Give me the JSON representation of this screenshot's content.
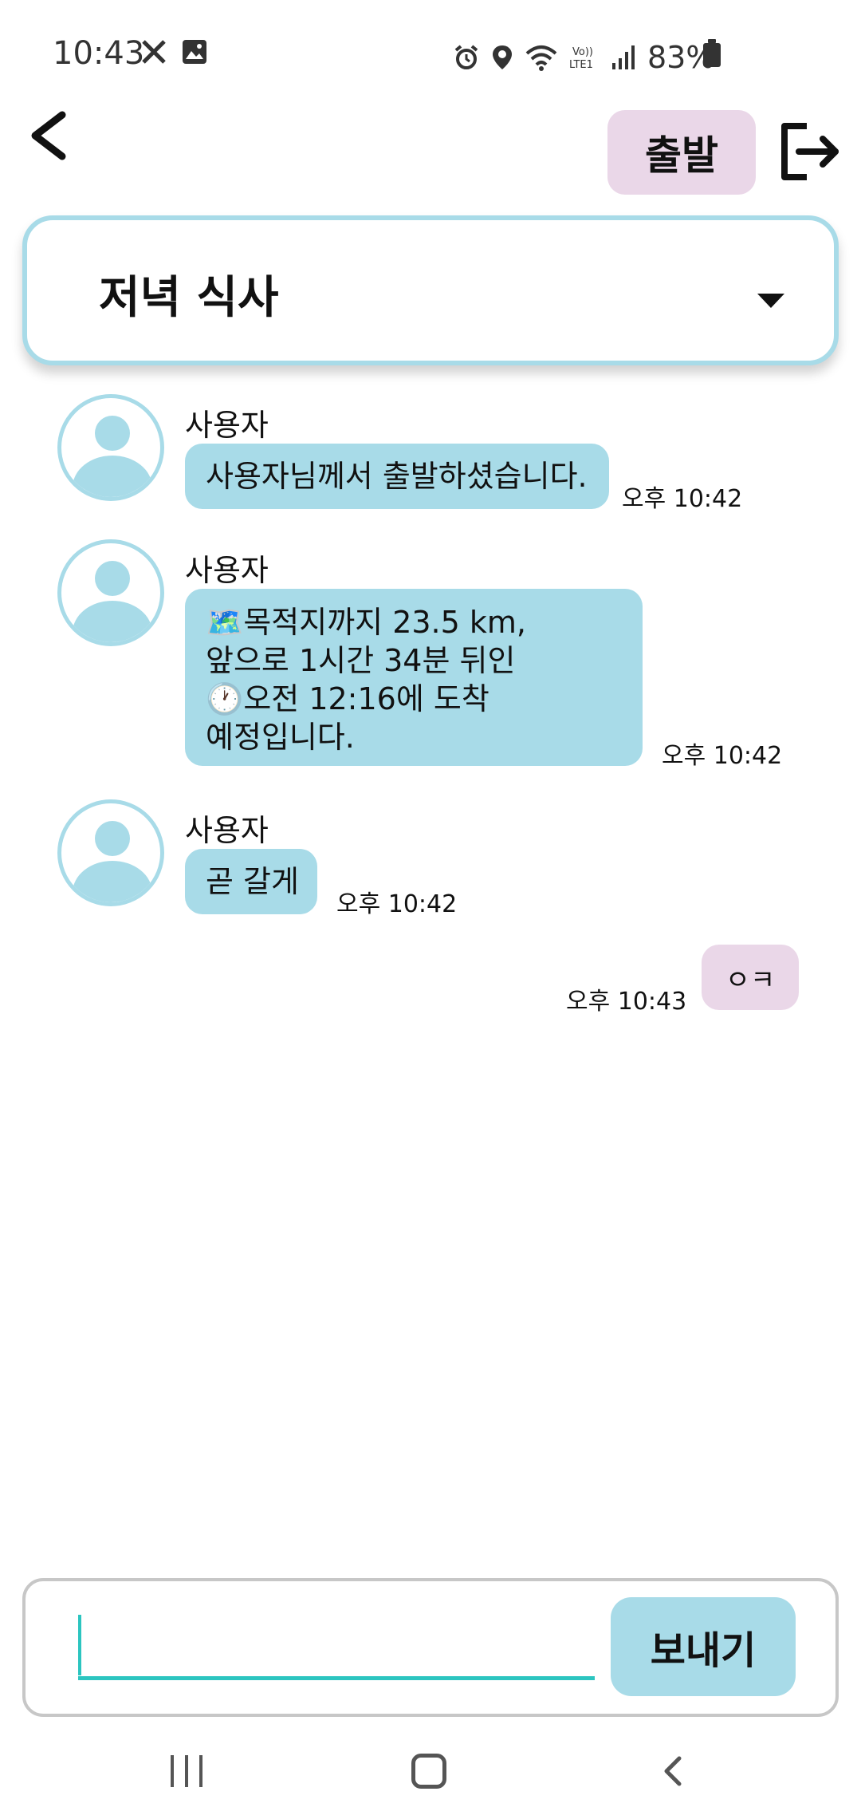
{
  "status_bar": {
    "time": "10:43",
    "battery": "83%",
    "left_icons": [
      "x-icon",
      "image-icon"
    ],
    "right_icons": [
      "alarm-icon",
      "location-icon",
      "wifi-icon",
      "volte-icon",
      "signal-icon",
      "battery-icon"
    ]
  },
  "header": {
    "depart_label": "출발"
  },
  "room_select": {
    "selected": "저녁 식사"
  },
  "messages": [
    {
      "sender": "사용자",
      "lines": [
        "사용자님께서 출발하셨습니다."
      ],
      "time": "오후 10:42"
    },
    {
      "sender": "사용자",
      "lines": [
        "🗺️목적지까지 23.5 km,",
        "앞으로 1시간 34분 뒤인",
        "🕐오전 12:16에 도착",
        "예정입니다."
      ],
      "time": "오후 10:42"
    },
    {
      "sender": "사용자",
      "lines": [
        "곧 갈게"
      ],
      "time": "오후 10:42"
    },
    {
      "mine": true,
      "text": "ㅇㅋ",
      "time": "오후 10:43"
    }
  ],
  "input": {
    "value": "",
    "placeholder": "",
    "send_label": "보내기"
  },
  "colors": {
    "accent_blue": "#a8dbe8",
    "accent_pink": "#ead7e8",
    "input_underline": "#2cc5c0"
  }
}
